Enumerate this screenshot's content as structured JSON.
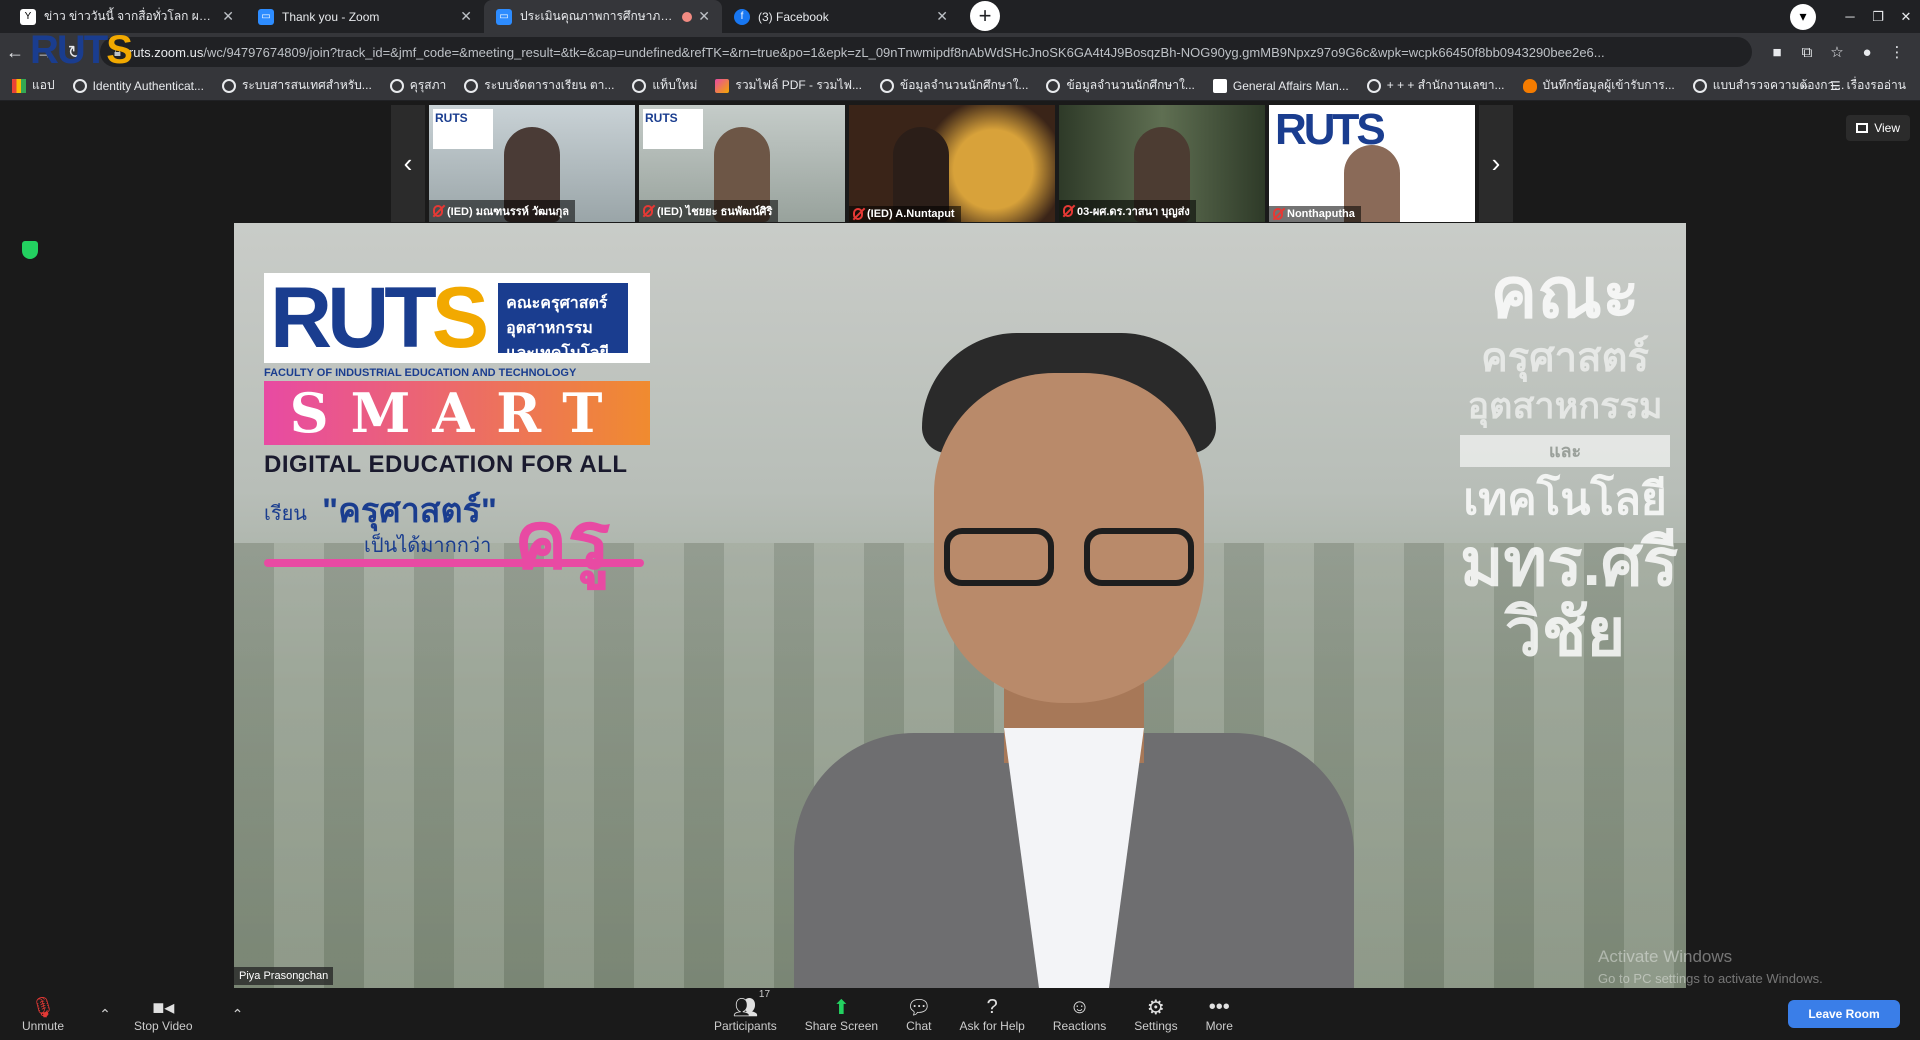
{
  "browser": {
    "tabs": [
      {
        "title": "ข่าว ข่าววันนี้ จากสื่อทั่วโลก ผลบอลโล",
        "favicon_color": "#ffffff",
        "favicon_glyph": "Y",
        "recording": false
      },
      {
        "title": "Thank you - Zoom",
        "favicon_color": "#2d8cff",
        "favicon_glyph": "▭",
        "recording": false
      },
      {
        "title": "ประเมินคุณภาพการศึกษาภายใน ร",
        "favicon_color": "#2d8cff",
        "favicon_glyph": "▭",
        "recording": true
      },
      {
        "title": "(3) Facebook",
        "favicon_color": "#1877f2",
        "favicon_glyph": "f",
        "recording": false
      }
    ],
    "address": {
      "host": "ruts.zoom.us",
      "path": "/wc/94797674809/join?track_id=&jmf_code=&meeting_result=&tk=&cap=undefined&refTK=&rn=true&po=1&epk=zL_09nTnwmipdf8nAbWdSHcJnoSK6GA4t4J9BosqzBh-NOG90yg.gmMB9Npxz97o9G6c&wpk=wcpk66450f8bb0943290bee2e6..."
    },
    "bookmarks": [
      {
        "label": "แอป",
        "icon": "apps-icon"
      },
      {
        "label": "Identity Authenticat...",
        "icon": "globe-icon"
      },
      {
        "label": "ระบบสารสนเทศสำหรับ...",
        "icon": "globe-icon"
      },
      {
        "label": "คุรุสภา",
        "icon": "globe-icon"
      },
      {
        "label": "ระบบจัดตารางเรียน ตา...",
        "icon": "globe-icon"
      },
      {
        "label": "แท็บใหม่",
        "icon": "globe-icon"
      },
      {
        "label": "รวมไฟล์ PDF - รวมไฟ...",
        "icon": "pdf-icon"
      },
      {
        "label": "ข้อมูลจำนวนนักศึกษาใ...",
        "icon": "globe-icon"
      },
      {
        "label": "ข้อมูลจำนวนนักศึกษาใ...",
        "icon": "globe-icon"
      },
      {
        "label": "General Affairs Man...",
        "icon": "page-icon"
      },
      {
        "label": "+ + + สำนักงานเลขา...",
        "icon": "globe-icon"
      },
      {
        "label": "บันทึกข้อมูลผู้เข้ารับการ...",
        "icon": "fire-icon"
      },
      {
        "label": "แบบสำรวจความต้องกา...",
        "icon": "globe-icon"
      }
    ],
    "reading_list": "เรื่องรออ่าน",
    "overflow": "»"
  },
  "zoom": {
    "view_label": "View",
    "thumbnails": [
      {
        "name": "(IED) มณฑนรรห์ วัฒนกุล",
        "bg": "#b7c2c8",
        "person": "#5a4a44"
      },
      {
        "name": "(IED) ไชยยะ ธนพัฒน์ศิริ",
        "bg": "#b9c0bd",
        "person": "#6d5646"
      },
      {
        "name": "(IED) A.Nuntaput",
        "bg": "#3a2418",
        "person": "#3b2b22"
      },
      {
        "name": "03-ผศ.ดร.วาสนา บุญส่ง",
        "bg": "#2e3a28",
        "person": "#4c3c32"
      },
      {
        "name": "Nonthaputha",
        "bg": "#ffffff",
        "person": "#8a6a58"
      }
    ],
    "speaker_name": "Piya Prasongchan",
    "background_logo": {
      "brand": "RUTS",
      "faculty": "คณะครุศาสตร์ อุตสาหกรรมและเทคโนโลยี",
      "faculty_en": "FACULTY OF INDUSTRIAL EDUCATION AND TECHNOLOGY",
      "smart": "SMART",
      "tagline": "DIGITAL EDUCATION FOR ALL",
      "kru_a": "เรียน",
      "kru_b": "\"ครุศาสตร์\"",
      "kru_c": "เป็นได้มากกว่า",
      "kru_d": "ครู"
    },
    "right_text": {
      "l1": "คณะ",
      "l2": "ครุศาสตร์",
      "l3": "อุตสาหกรรม",
      "l4": "และ",
      "l5": "เทคโนโลยี",
      "l6": "มทร.ศรีวิชัย"
    },
    "watermark": {
      "title": "Activate Windows",
      "sub": "Go to PC settings to activate Windows."
    },
    "controls": {
      "unmute": "Unmute",
      "stop_video": "Stop Video",
      "participants": "Participants",
      "participants_count": "17",
      "share_screen": "Share Screen",
      "chat": "Chat",
      "ask_help": "Ask for Help",
      "reactions": "Reactions",
      "settings": "Settings",
      "more": "More",
      "leave": "Leave Room"
    }
  }
}
